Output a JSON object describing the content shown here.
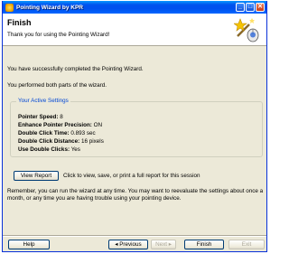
{
  "window": {
    "title": "Pointing Wizard by KPR",
    "buttons": {
      "minimize": "_",
      "maximize": "□",
      "close": "✕"
    }
  },
  "header": {
    "title": "Finish",
    "subtitle": "Thank you for using the Pointing Wizard!",
    "icon": "mouse-wand-icon"
  },
  "body": {
    "completed_text": "You have successfully completed the Pointing Wizard.",
    "performed_text": "You performed both parts of the wizard.",
    "settings_group": {
      "title": "Your Active Settings",
      "items": [
        {
          "label": "Pointer Speed:",
          "value": "8"
        },
        {
          "label": "Enhance Pointer Precision:",
          "value": "ON"
        },
        {
          "label": "Double Click Time:",
          "value": "0.893 sec"
        },
        {
          "label": "Double Click Distance:",
          "value": "16 pixels"
        },
        {
          "label": "Use Double Clicks:",
          "value": "Yes"
        }
      ]
    },
    "view_report_label": "View Report",
    "view_report_desc": "Click to view, save, or print a full report for this session",
    "reminder_text": "Remember, you can run the wizard at any time. You may want to reevaluate the settings about once a month, or any time you are having trouble using your pointing device."
  },
  "footer": {
    "help_label": "Help",
    "previous_label": "◂ Previous",
    "next_label": "Next ▸",
    "finish_label": "Finish",
    "exit_label": "Exit"
  },
  "colors": {
    "title_bar": "#0053ee",
    "group_title": "#0046d5",
    "window_bg": "#ece9d8"
  }
}
